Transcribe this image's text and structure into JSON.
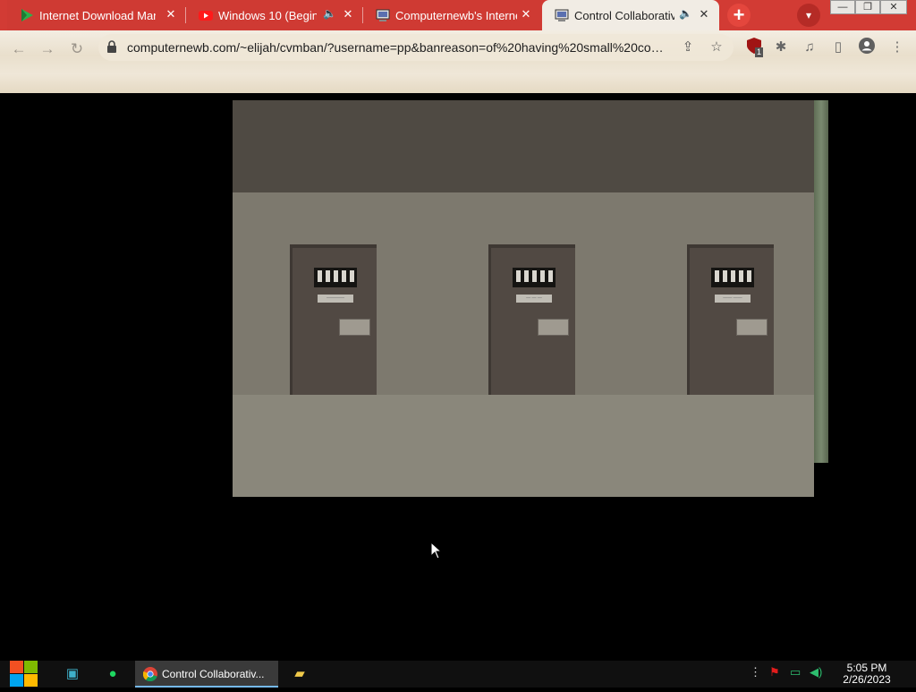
{
  "browser": {
    "tabs": [
      {
        "title": "Internet Download Mana",
        "icon": "idm-icon",
        "active": false
      },
      {
        "title": "Windows 10 (Begin",
        "icon": "youtube-icon",
        "audio": true,
        "active": false
      },
      {
        "title": "Computernewb's Interne",
        "icon": "computer-icon",
        "active": false
      },
      {
        "title": "Control Collaborativ",
        "icon": "computer-icon",
        "audio": true,
        "active": true
      }
    ],
    "new_tab_label": "+",
    "url": "computernewb.com/~elijah/cvmban/?username=pp&banreason=of%20having%20small%20co…",
    "extension_badge": "1"
  },
  "game": {
    "doors": [
      {
        "plate_text": "————"
      },
      {
        "plate_text": "— — —"
      },
      {
        "plate_text": "—— ——"
      }
    ]
  },
  "taskbar": {
    "app_label": "Control Collaborativ...",
    "time": "5:05 PM",
    "date": "2/26/2023"
  },
  "colors": {
    "tab_strip": "#d23b34",
    "ceiling": "#4f4a43",
    "wall": "#7d796e",
    "floor": "#8a877b",
    "door": "#514943"
  }
}
